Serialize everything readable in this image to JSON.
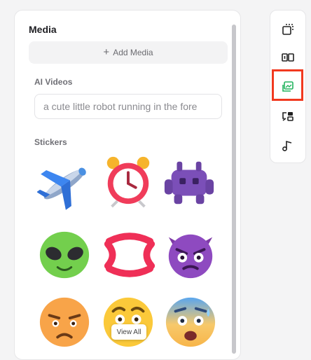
{
  "media": {
    "title": "Media",
    "add_label": "Add Media",
    "ai_videos_label": "AI Videos",
    "prompt_value": "a cute little robot running in the fore",
    "stickers_label": "Stickers",
    "view_all_label": "View All",
    "stickers": [
      "airplane",
      "alarm-clock",
      "alien-monster",
      "alien",
      "anger-symbol",
      "angry-face-with-horns",
      "frowning-face",
      "face-with-raised-eyebrow",
      "anxious-face-with-sweat"
    ]
  },
  "rail": {
    "items": [
      "template-icon",
      "layout-icon",
      "media-icon",
      "text-icon",
      "audio-icon"
    ],
    "active": "media-icon",
    "active_color": "#22b35e",
    "highlight_color": "#f1391f"
  }
}
